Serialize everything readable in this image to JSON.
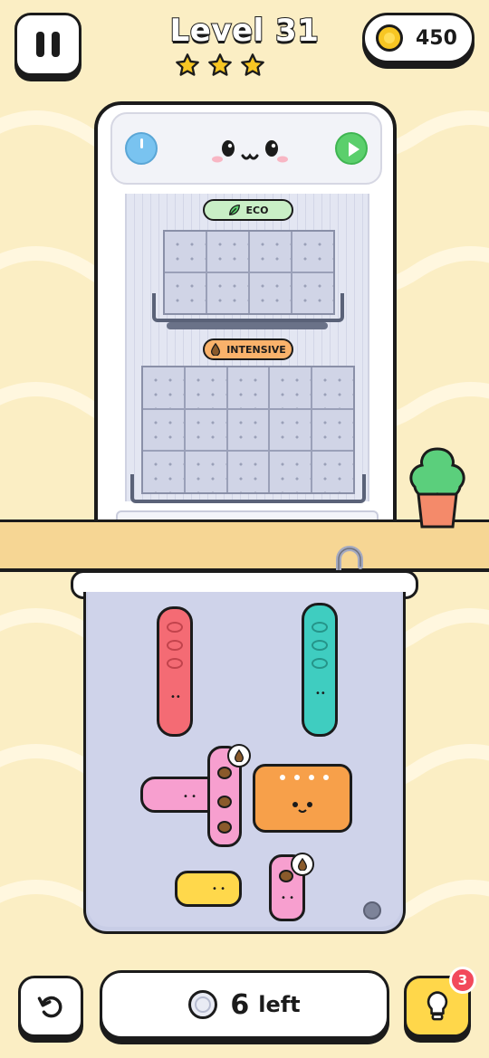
{
  "header": {
    "level_title": "Level 31",
    "stars": 3,
    "coins": "450"
  },
  "dishwasher": {
    "rack_top_label": "ECO",
    "rack_bottom_label": "INTENSIVE",
    "rack_top_grid": {
      "cols": 4,
      "rows": 2
    },
    "rack_bottom_grid": {
      "cols": 5,
      "rows": 3
    }
  },
  "footer": {
    "remaining_count": "6",
    "remaining_label": "left",
    "hint_badge": "3"
  },
  "colors": {
    "background": "#fbeec4",
    "red_piece": "#f46b74",
    "teal_piece": "#3fcdc0",
    "pink_piece": "#f79fcf",
    "orange_pot": "#f7a04a",
    "yellow_piece": "#ffd84b",
    "hint_button": "#ffd74a",
    "badge": "#f2495b"
  },
  "icons": [
    "pause-icon",
    "star-icon",
    "coin-icon",
    "power-knob-icon",
    "play-icon",
    "leaf-icon",
    "drop-icon",
    "undo-icon",
    "plate-icon",
    "lightbulb-icon"
  ]
}
